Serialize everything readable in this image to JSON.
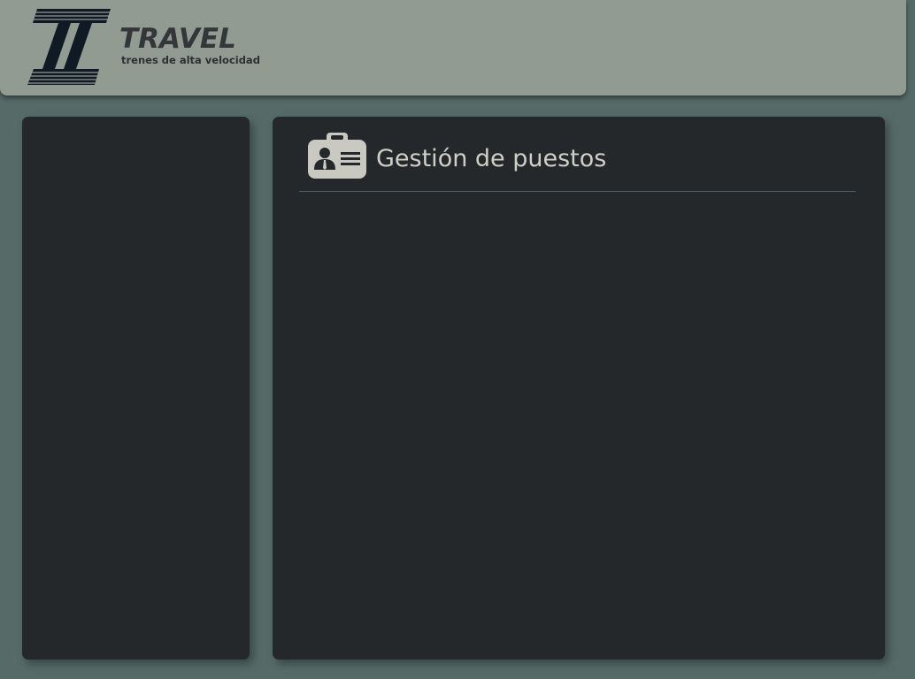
{
  "header": {
    "logo_icon": "ti-rail-logo-icon",
    "brand_title": "TRAVEL",
    "brand_subtitle": "trenes de alta velocidad"
  },
  "main": {
    "section_icon": "id-badge-icon",
    "section_title": "Gestión de puestos"
  },
  "colors": {
    "background": "#566b67",
    "header": "#929b91",
    "panel": "#24282b",
    "title_text": "#cfcfc8",
    "logo": "#101a24"
  }
}
